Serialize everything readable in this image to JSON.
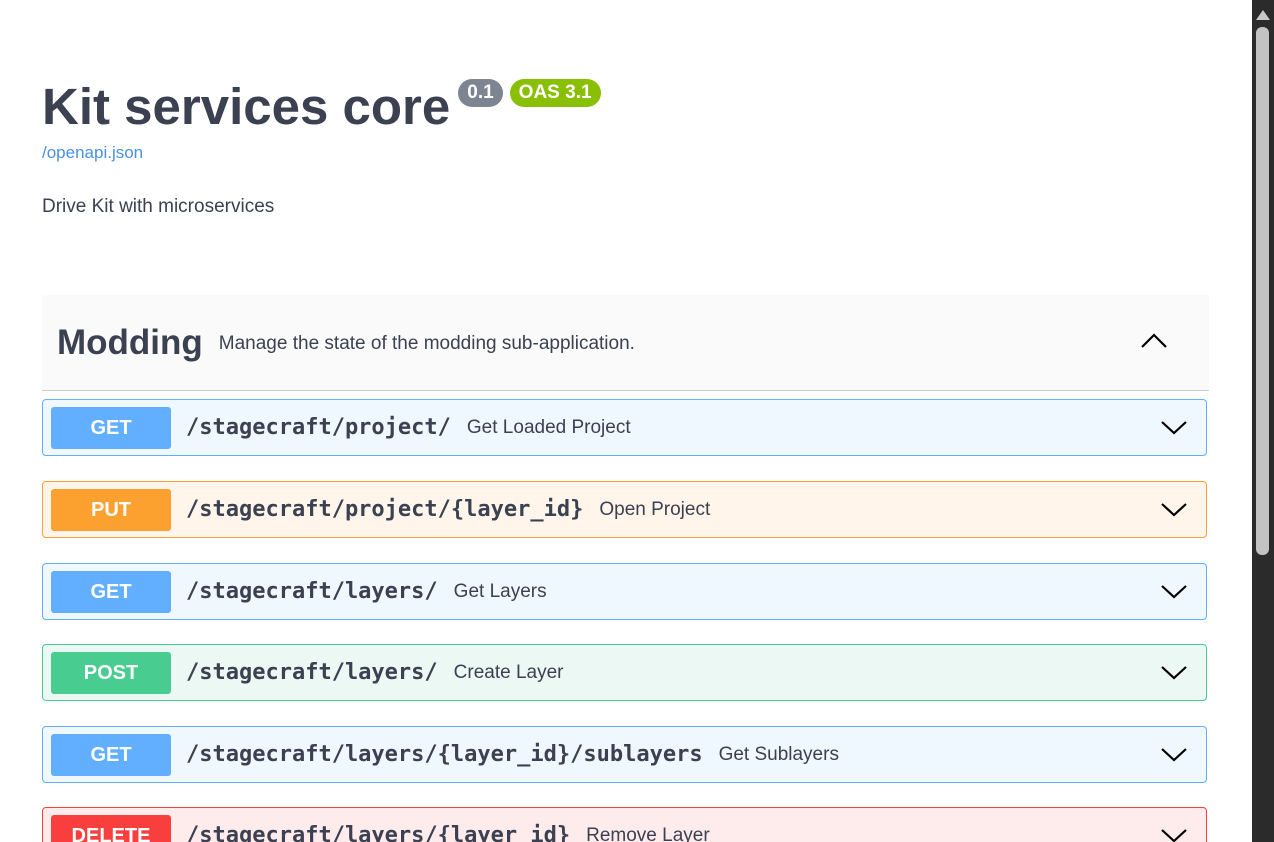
{
  "info": {
    "title": "Kit services core",
    "version": "0.1",
    "oas": "OAS 3.1",
    "spec_link": "/openapi.json",
    "description": "Drive Kit with microservices"
  },
  "colors": {
    "get": "#61affe",
    "put": "#fca130",
    "post": "#49cc90",
    "delete": "#f93e3e",
    "version_badge": "#7d8492",
    "oas_badge": "#89bf04",
    "link": "#4990e2"
  },
  "tag": {
    "name": "Modding",
    "description": "Manage the state of the modding sub-application.",
    "toggle_icon": "chevron-up-icon"
  },
  "operations": [
    {
      "method": "GET",
      "path": "/stagecraft/project/",
      "summary": "Get Loaded Project"
    },
    {
      "method": "PUT",
      "path": "/stagecraft/project/{layer_id}",
      "summary": "Open Project"
    },
    {
      "method": "GET",
      "path": "/stagecraft/layers/",
      "summary": "Get Layers"
    },
    {
      "method": "POST",
      "path": "/stagecraft/layers/",
      "summary": "Create Layer"
    },
    {
      "method": "GET",
      "path": "/stagecraft/layers/{layer_id}/sublayers",
      "summary": "Get Sublayers"
    },
    {
      "method": "DELETE",
      "path": "/stagecraft/layers/{layer_id}",
      "summary": "Remove Layer"
    }
  ]
}
